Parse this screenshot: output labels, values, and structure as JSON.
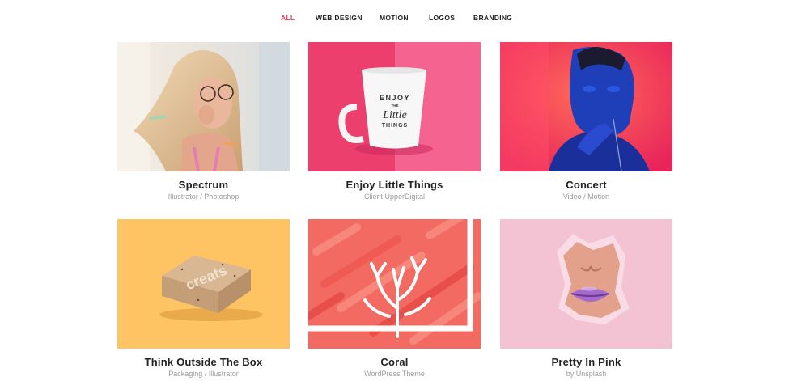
{
  "filters": [
    "ALL",
    "WEB DESIGN",
    "MOTION",
    "LOGOS",
    "BRANDING"
  ],
  "active_filter": "ALL",
  "accent_color": "#e8404a",
  "projects": [
    {
      "title": "Spectrum",
      "category": "Illustrator / Photoshop",
      "image": "woman-with-glasses-photo"
    },
    {
      "title": "Enjoy Little Things",
      "category": "Client UpperDigital",
      "image": "mug-on-pink-photo",
      "mug_text": [
        "ENJOY",
        "THE",
        "Little",
        "THINGS"
      ]
    },
    {
      "title": "Concert",
      "category": "Video / Motion",
      "image": "man-in-blue-paint-photo"
    },
    {
      "title": "Think Outside The Box",
      "category": "Packaging / Illustrator",
      "image": "cardboard-box-photo",
      "box_text": "creats"
    },
    {
      "title": "Coral",
      "category": "WordPress Theme",
      "image": "coral-illustration"
    },
    {
      "title": "Pretty In Pink",
      "category": "by Unsplash",
      "image": "lips-through-paper-photo"
    }
  ]
}
